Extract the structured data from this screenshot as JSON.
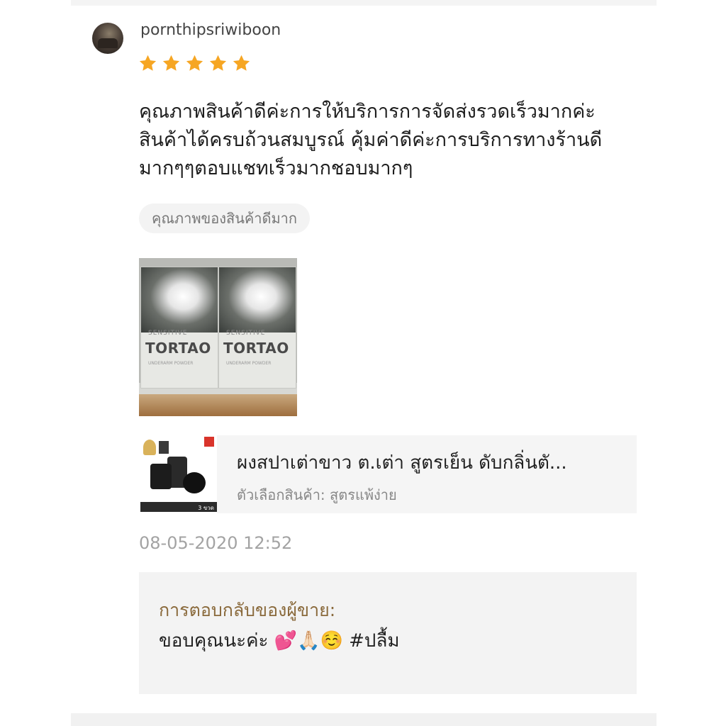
{
  "review": {
    "username": "pornthipsriwiboon",
    "rating": 5,
    "max_rating": 5,
    "star_color": "#f6a623",
    "text_lines": [
      "คุณภาพสินค้าดีค่ะการให้บริการการจัดส่งรวดเร็วมากค่ะ",
      "สินค้าได้ครบถ้วนสมบูรณ์ คุ้มค่าดีค่ะการบริการทางร้านดี",
      "มากๆๆตอบแชทเร็วมากชอบมากๆ"
    ],
    "tag": "คุณภาพของสินค้าดีมาก",
    "photo": {
      "box_texts": [
        "SENSITIVE",
        "TORTAO",
        "UNDERARM POWDER"
      ]
    },
    "product": {
      "name": "ผงสปาเต่าขาว ต.เต่า สูตรเย็น ดับกลิ่นตั...",
      "variant": "ตัวเลือกสินค้า: สูตรแพ้ง่าย",
      "thumb_price": "3 ขวด"
    },
    "timestamp": "08-05-2020 12:52"
  },
  "seller_reply": {
    "label": "การตอบกลับของผู้ขาย:",
    "text": "ขอบคุณนะค่ะ 💕🙏🏻☺️ #ปลื้ม"
  }
}
